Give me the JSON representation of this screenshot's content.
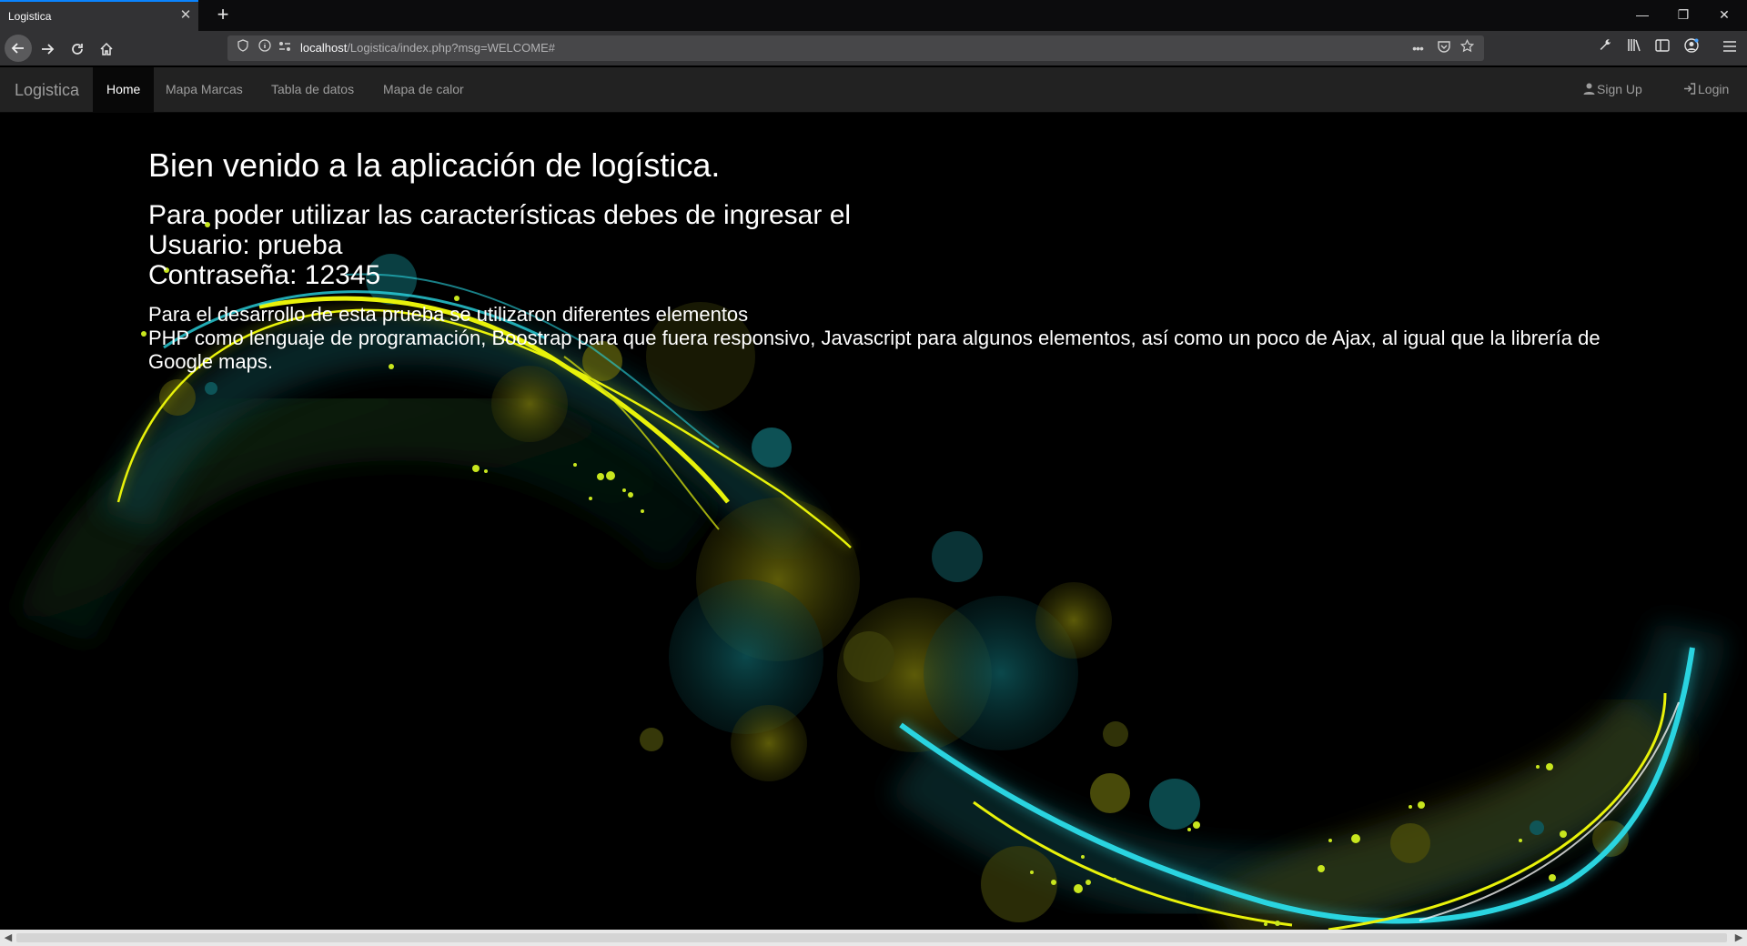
{
  "browser": {
    "tab_title": "Logistica",
    "tab_close": "✕",
    "new_tab": "+",
    "window": {
      "minimize": "—",
      "restore": "❐",
      "close": "✕"
    },
    "url_host": "localhost",
    "url_path": "/Logistica/index.php?msg=WELCOME#",
    "page_actions": "•••"
  },
  "site": {
    "brand": "Logistica",
    "nav": [
      {
        "label": "Home",
        "active": true
      },
      {
        "label": "Mapa Marcas",
        "active": false
      },
      {
        "label": "Tabla de datos",
        "active": false
      },
      {
        "label": "Mapa de calor",
        "active": false
      }
    ],
    "signup": "Sign Up",
    "login": "Login"
  },
  "content": {
    "welcome": "Bien venido a la aplicación de logística.",
    "login_intro": "Para poder utilizar las características debes de ingresar el",
    "user_line": "Usuario: prueba",
    "pass_line": "Contraseña: 12345",
    "dev_line": "Para el desarrollo de esta prueba se utilizaron diferentes elementos",
    "tech_line": "PHP como lenguaje de programación, Boostrap para que fuera responsivo, Javascript para algunos elementos, así como un poco de Ajax, al igual que la librería de Google maps."
  },
  "colors": {
    "accent_tab": "#0a84ff",
    "navbar_bg": "#222222",
    "wave_yellow": "#e8f20a",
    "wave_cyan": "#2ad4e0"
  },
  "icons": {
    "back": "arrow-left-icon",
    "forward": "arrow-right-icon",
    "reload": "reload-icon",
    "home": "home-icon",
    "signup": "user-icon",
    "login": "login-icon"
  }
}
